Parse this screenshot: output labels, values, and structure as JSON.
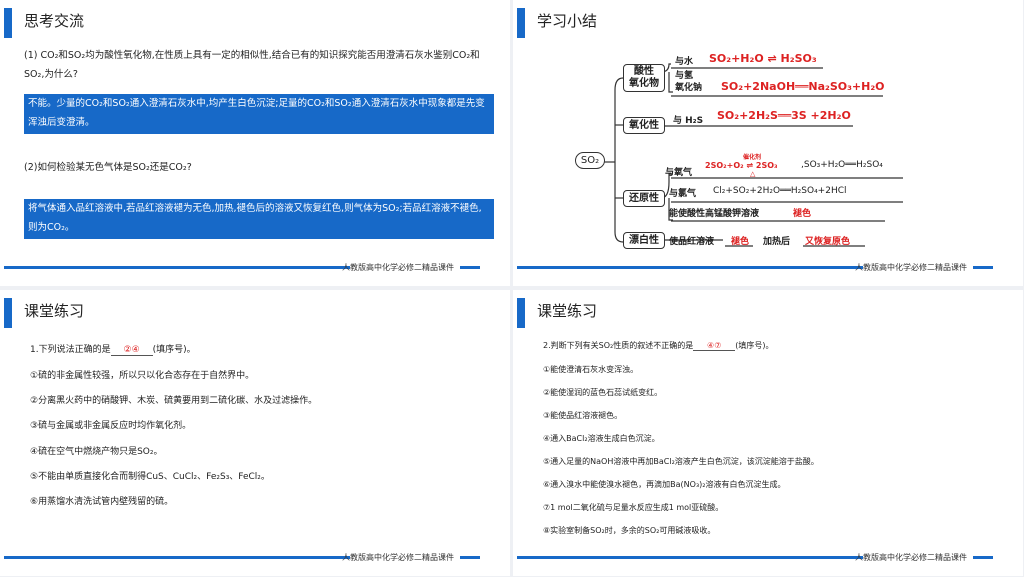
{
  "footer": "人教版高中化学必修二精品课件",
  "slide1": {
    "title": "思考交流",
    "q1": "(1) CO₂和SO₂均为酸性氧化物,在性质上具有一定的相似性,结合已有的知识探究能否用澄清石灰水鉴别CO₂和SO₂,为什么?",
    "a1": "不能。少量的CO₂和SO₂通入澄清石灰水中,均产生白色沉淀;足量的CO₂和SO₂通入澄清石灰水中现象都是先变浑浊后变澄清。",
    "q2": "(2)如何检验某无色气体是SO₂还是CO₂?",
    "a2": "将气体通入品红溶液中,若品红溶液褪为无色,加热,褪色后的溶液又恢复红色,则气体为SO₂;若品红溶液不褪色,则为CO₂。"
  },
  "slide2": {
    "title": "学习小结",
    "root": "SO₂",
    "acid_node": "酸性\n氧化物",
    "acid_water_label": "与水",
    "acid_water_eq": "SO₂+H₂O ⇌ H₂SO₃",
    "acid_base_label": "与氢\n氧化钠",
    "acid_base_eq": "SO₂+2NaOH══Na₂SO₃+H₂O",
    "ox_node": "氧化性",
    "ox_label": "与 H₂S",
    "ox_eq": "SO₂+2H₂S══3S +2H₂O",
    "red_node": "还原性",
    "red_o2_label": "与氧气",
    "red_o2_eq": "2SO₂+O₂ ⇌ 2SO₃",
    "red_o2_cat": "催化剂",
    "red_o2_heat": "△",
    "red_o2_eq2": ",SO₃+H₂O══H₂SO₄",
    "red_cl_label": "与氯气",
    "red_cl_eq": "Cl₂+SO₂+2H₂O══H₂SO₄+2HCl",
    "red_kmno4": "能使酸性高锰酸钾溶液",
    "red_kmno4_result": "褪色",
    "bleach_node": "漂白性",
    "bleach_text": "使品红溶液",
    "bleach_result": "褪色",
    "bleach_heat": "加热后",
    "bleach_result2": "又恢复原色"
  },
  "slide3": {
    "title": "课堂练习",
    "q_prefix": "1.下列说法正确的是",
    "q_answer": "②④",
    "q_suffix": "(填序号)。",
    "items": [
      "①硫的非金属性较强，所以只以化合态存在于自然界中。",
      "②分离黑火药中的硝酸钾、木炭、硫黄要用到二硫化碳、水及过滤操作。",
      "③硫与金属或非金属反应时均作氧化剂。",
      "④硫在空气中燃烧产物只是SO₂。",
      "⑤不能由单质直接化合而制得CuS、CuCl₂、Fe₂S₃、FeCl₂。",
      "⑥用蒸馏水清洗试管内壁残留的硫。"
    ]
  },
  "slide4": {
    "title": "课堂练习",
    "q_prefix": "2.判断下列有关SO₂性质的叙述不正确的是",
    "q_answer": "④⑦",
    "q_suffix": "(填序号)。",
    "items": [
      "①能使澄清石灰水变浑浊。",
      "②能使湿润的蓝色石蕊试纸变红。",
      "③能使品红溶液褪色。",
      "④通入BaCl₂溶液生成白色沉淀。",
      "⑤通入足量的NaOH溶液中再加BaCl₂溶液产生白色沉淀，该沉淀能溶于盐酸。",
      "⑥通入溴水中能使溴水褪色，再滴加Ba(NO₃)₂溶液有白色沉淀生成。",
      "⑦1 mol二氧化硫与足量水反应生成1 mol亚硫酸。",
      "⑧实验室制备SO₂时，多余的SO₂可用碱液吸收。"
    ]
  }
}
